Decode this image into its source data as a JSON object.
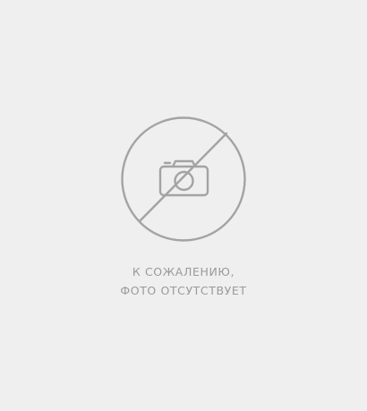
{
  "placeholder": {
    "icon": "no-photo-camera-icon",
    "message_line1": "К СОЖАЛЕНИЮ,",
    "message_line2": "ФОТО ОТСУТСТВУЕТ",
    "colors": {
      "background": "#efefef",
      "icon_stroke": "#a3a3a3",
      "text": "#9a9a9a"
    }
  }
}
